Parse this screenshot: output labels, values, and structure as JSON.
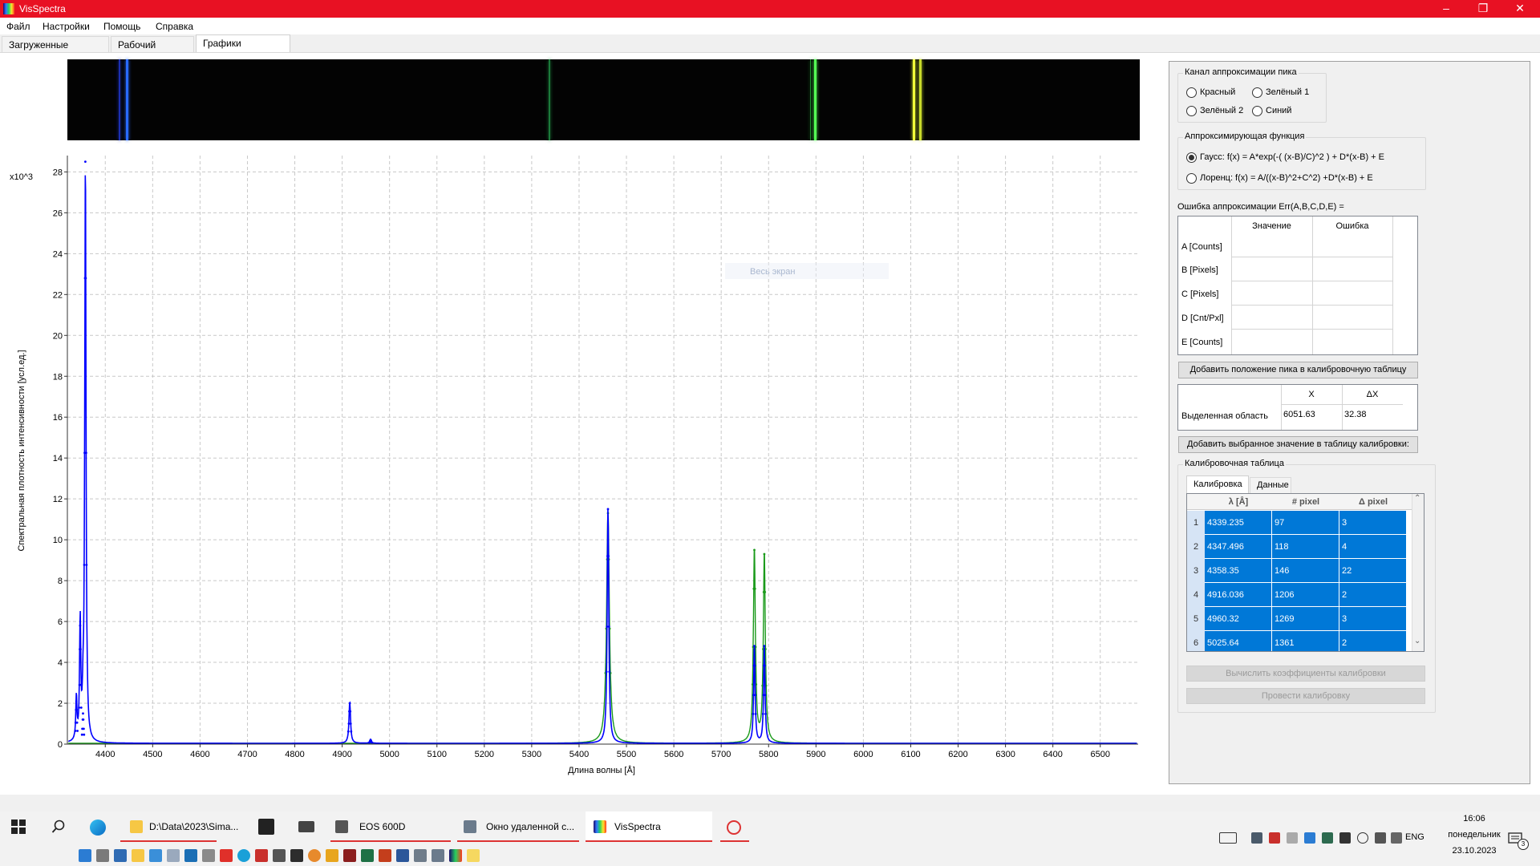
{
  "window": {
    "title": "VisSpectra",
    "controls": [
      "–",
      "❐",
      "✕"
    ]
  },
  "menu": [
    "Файл",
    "Настройки",
    "Помощь",
    "Справка"
  ],
  "tabs": [
    "Загруженные спектры",
    "Рабочий спектр",
    "Графики спектров"
  ],
  "active_tab": "Графики спектров",
  "strip": {
    "lines": [
      {
        "pos": 0.0545,
        "color": "#2a6bff",
        "width": 3
      },
      {
        "pos": 0.0475,
        "color": "#1b2fb0",
        "width": 2
      },
      {
        "pos": 0.449,
        "color": "#1b7a3a",
        "width": 2
      },
      {
        "pos": 0.6965,
        "color": "#55ff55",
        "width": 3
      },
      {
        "pos": 0.6925,
        "color": "#1c8a2c",
        "width": 1
      },
      {
        "pos": 0.7885,
        "color": "#f2ff3a",
        "width": 3
      },
      {
        "pos": 0.7945,
        "color": "#c7d92a",
        "width": 3
      }
    ]
  },
  "chart": {
    "multiplier_label": "x10^3",
    "ylabel": "Спектральная плотность интенсивности [усл.ед.]",
    "xlabel": "Длина волны  [Å]",
    "hover_hint": "Весь экран"
  },
  "chart_data": {
    "type": "line",
    "xlim": [
      4320,
      6580
    ],
    "ylim": [
      0,
      28.8
    ],
    "x_ticks": [
      4400,
      4500,
      4600,
      4700,
      4800,
      4900,
      5000,
      5100,
      5200,
      5300,
      5400,
      5500,
      5600,
      5700,
      5800,
      5900,
      6000,
      6100,
      6200,
      6300,
      6400,
      6500
    ],
    "y_ticks": [
      0,
      2,
      4,
      6,
      8,
      10,
      12,
      14,
      16,
      18,
      20,
      22,
      24,
      26,
      28
    ],
    "grid": true,
    "series": [
      {
        "color": "#0000ff",
        "peaks": [
          {
            "x": 4339,
            "y": 2.1,
            "w": 1.5
          },
          {
            "x": 4347,
            "y": 5.8,
            "w": 1.5
          },
          {
            "x": 4353,
            "y": 1.5,
            "w": 1.5
          },
          {
            "x": 4358,
            "y": 28.5,
            "w": 1.6
          },
          {
            "x": 4916,
            "y": 2.0,
            "w": 2.0
          },
          {
            "x": 4960,
            "y": 0.2,
            "w": 2.0
          },
          {
            "x": 5461,
            "y": 11.5,
            "w": 2.0
          },
          {
            "x": 5770,
            "y": 4.8,
            "w": 1.8
          },
          {
            "x": 5791,
            "y": 4.8,
            "w": 1.8
          }
        ]
      },
      {
        "color": "#1a9a1a",
        "peaks": [
          {
            "x": 5461,
            "y": 11.3,
            "w": 3.5
          },
          {
            "x": 5770,
            "y": 9.5,
            "w": 2.5
          },
          {
            "x": 5791,
            "y": 9.3,
            "w": 2.5
          }
        ]
      }
    ]
  },
  "panel": {
    "channel_title": "Канал аппроксимации пика",
    "channels": [
      {
        "label": "Красный",
        "checked": false
      },
      {
        "label": "Зелёный 1",
        "checked": false
      },
      {
        "label": "Зелёный 2",
        "checked": false
      },
      {
        "label": "Синий",
        "checked": false
      }
    ],
    "func_title": "Аппроксимирующая функция",
    "funcs": [
      {
        "label": "Гаусс: f(x) =  A*exp(-( (x-B)/C)^2 ) + D*(x-B) + E",
        "checked": true
      },
      {
        "label": "Лоренц: f(x) = A/((x-B)^2+C^2) +D*(x-B) + E",
        "checked": false
      }
    ],
    "err_label": "Ошибка аппроксимации Err(A,B,C,D,E) =",
    "params_headers": [
      "Значение",
      "Ошибка"
    ],
    "params": [
      "A [Counts]",
      "B [Pixels]",
      "C [Pixels]",
      "D [Cnt/Pxl]",
      "E [Counts]"
    ],
    "add_peak_btn": "Добавить положение пика в калибровочную таблицу",
    "sel_headers": [
      "X",
      "ΔX"
    ],
    "sel_label": "Выделенная область",
    "sel_x": "6051.63",
    "sel_dx": "32.38",
    "add_value_btn": "Добавить выбранное значение в таблицу калибровки:",
    "calib_title": "Калибровочная таблица",
    "calib_tabs": [
      "Калибровка",
      "Данные"
    ],
    "calib_headers": [
      "λ [Å]",
      "# pixel",
      "Δ pixel"
    ],
    "calib_rows": [
      [
        "1",
        "4339.235",
        "97",
        "3"
      ],
      [
        "2",
        "4347.496",
        "118",
        "4"
      ],
      [
        "3",
        "4358.35",
        "146",
        "22"
      ],
      [
        "4",
        "4916.036",
        "1206",
        "2"
      ],
      [
        "5",
        "4960.32",
        "1269",
        "3"
      ],
      [
        "6",
        "5025.64",
        "1361",
        "2"
      ]
    ],
    "calc_btn": "Вычислить коэффициенты калибровки",
    "run_btn": "Провести калибровку"
  },
  "taskbar": {
    "items": [
      {
        "label": "D:\\Data\\2023\\Sima..."
      },
      {
        "label": "EOS 600D"
      },
      {
        "label": "Окно удаленной с..."
      },
      {
        "label": "VisSpectra"
      }
    ],
    "lang": "ENG",
    "time": "16:06",
    "day": "понедельник",
    "date": "23.10.2023",
    "notif_count": "3"
  }
}
